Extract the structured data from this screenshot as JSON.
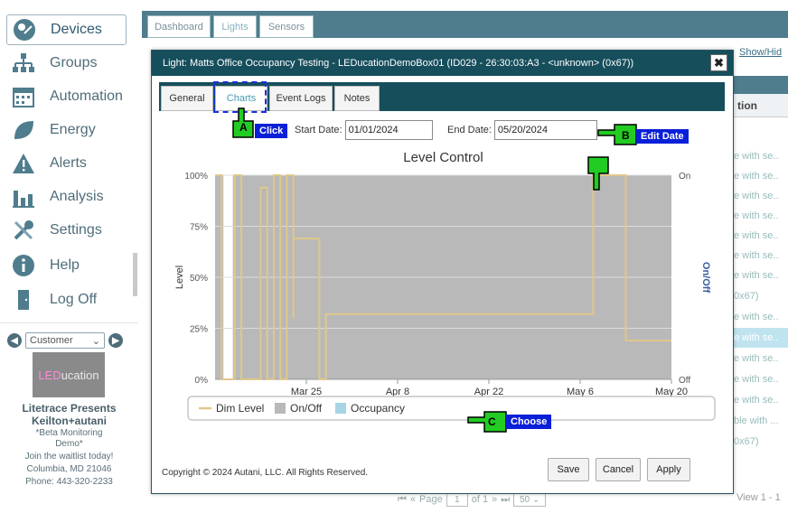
{
  "sidebar": {
    "items": [
      {
        "label": "Devices",
        "icon": "devices-icon",
        "active": true
      },
      {
        "label": "Groups",
        "icon": "groups-icon",
        "active": false
      },
      {
        "label": "Automation",
        "icon": "calendar-icon",
        "active": false
      },
      {
        "label": "Energy",
        "icon": "leaf-icon",
        "active": false
      },
      {
        "label": "Alerts",
        "icon": "warning-icon",
        "active": false
      },
      {
        "label": "Analysis",
        "icon": "bar-chart-icon",
        "active": false
      },
      {
        "label": "Settings",
        "icon": "tools-icon",
        "active": false
      },
      {
        "label": "Help",
        "icon": "info-icon",
        "active": false
      },
      {
        "label": "Log Off",
        "icon": "door-icon",
        "active": false
      }
    ],
    "customer_select": "Customer",
    "logo_text_a": "LED",
    "logo_text_b": "ucation",
    "promo_title": "Litetrace Presents",
    "promo_brand": "Keilton+autani",
    "promo_beta": "*Beta Monitoring",
    "promo_demo": "Demo*",
    "promo_waitlist": "Join the waitlist today!",
    "promo_city": "Columbia, MD  21046",
    "promo_phone": "Phone: 443-320-2233"
  },
  "top_tabs": [
    {
      "label": "Dashboard",
      "selected": false
    },
    {
      "label": "Lights",
      "selected": true
    },
    {
      "label": "Sensors",
      "selected": false
    }
  ],
  "background": {
    "show_hide_link": "Show/Hid",
    "column_header": "tion",
    "rows": [
      "e with se..",
      "e with se..",
      "e with se..",
      "e with se..",
      "e with se..",
      "e with se..",
      "e with se..",
      "0x67)",
      "e with se..",
      "e with se..",
      "e with se..",
      "e with se..",
      "e with se..",
      "ble with ...",
      "0x67)"
    ],
    "pager_page": "Page",
    "pager_page_value": "1",
    "pager_of": "of 1",
    "pager_size": "50",
    "view_count": "View 1 - 1"
  },
  "modal": {
    "title": "Light: Matts Office Occupancy Testing - LEDucationDemoBox01 (ID029 - 26:30:03:A3 - <unknown> (0x67))",
    "close_label": "✖",
    "tabs": [
      {
        "label": "General",
        "selected": false
      },
      {
        "label": "Charts",
        "selected": true
      },
      {
        "label": "Event Logs",
        "selected": false
      },
      {
        "label": "Notes",
        "selected": false
      }
    ],
    "start_date_label": "Start Date:",
    "start_date_value": "01/01/2024",
    "end_date_label": "End Date:",
    "end_date_value": "05/20/2024",
    "footer_copyright": "Copyright © 2024 Autani, LLC. All Rights Reserved.",
    "buttons": {
      "save": "Save",
      "cancel": "Cancel",
      "apply": "Apply"
    }
  },
  "annotations": [
    {
      "letter": "A",
      "text": "Click"
    },
    {
      "letter": "B",
      "text": "Edit Date"
    },
    {
      "letter": "C",
      "text": "Choose"
    }
  ],
  "colors": {
    "dim_level": "#e0c88a",
    "on_off": "#b9b9b9",
    "occupancy": "#a8d4e6",
    "modal_header": "#164e5c",
    "annotation_label": "#0a1fd8",
    "annotation_hand": "#22cc22"
  },
  "chart_data": {
    "type": "line",
    "title": "Level Control",
    "ylabel": "Level",
    "y2label": "On/Off",
    "yticks": [
      "0%",
      "25%",
      "50%",
      "75%",
      "100%"
    ],
    "y2ticks": [
      "Off",
      "On"
    ],
    "xticks": [
      "Mar 25",
      "Apr 8",
      "Apr 22",
      "May 6",
      "May 20"
    ],
    "ylim": [
      0,
      100
    ],
    "xlim": [
      "2024-03-11",
      "2024-05-20"
    ],
    "legend": [
      "Dim Level",
      "On/Off",
      "Occupancy"
    ],
    "legend_position": "bottom",
    "series": [
      {
        "name": "Dim Level",
        "points": [
          [
            "2024-03-11",
            100
          ],
          [
            "2024-03-12",
            100
          ],
          [
            "2024-03-12",
            0
          ],
          [
            "2024-03-14",
            0
          ],
          [
            "2024-03-14",
            100
          ],
          [
            "2024-03-15",
            100
          ],
          [
            "2024-03-15",
            0
          ],
          [
            "2024-03-18",
            0
          ],
          [
            "2024-03-18",
            94
          ],
          [
            "2024-03-19",
            94
          ],
          [
            "2024-03-19",
            0
          ],
          [
            "2024-03-20",
            0
          ],
          [
            "2024-03-20",
            100
          ],
          [
            "2024-03-21",
            100
          ],
          [
            "2024-03-21",
            0
          ],
          [
            "2024-03-22",
            0
          ],
          [
            "2024-03-22",
            100
          ],
          [
            "2024-03-23",
            100
          ],
          [
            "2024-03-23",
            30
          ],
          [
            "2024-03-23",
            69
          ],
          [
            "2024-03-27",
            69
          ],
          [
            "2024-03-27",
            0
          ],
          [
            "2024-03-28",
            0
          ],
          [
            "2024-03-28",
            32
          ],
          [
            "2024-05-08",
            32
          ],
          [
            "2024-05-08",
            100
          ],
          [
            "2024-05-13",
            100
          ],
          [
            "2024-05-13",
            19
          ],
          [
            "2024-05-20",
            19
          ]
        ]
      },
      {
        "name": "On/Off",
        "points": [
          [
            "2024-03-11",
            1
          ],
          [
            "2024-05-20",
            1
          ]
        ]
      }
    ]
  }
}
